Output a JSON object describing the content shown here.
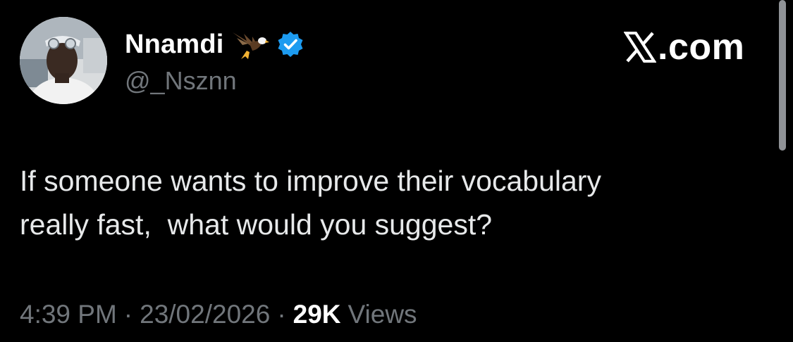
{
  "author": {
    "display_name": "Nnamdi",
    "emoji": "eagle-emoji",
    "verified": true,
    "verified_color": "#1d9bf0",
    "handle": "@_Nsznn",
    "avatar_icon": "profile-photo"
  },
  "watermark": {
    "logo": "x-logo-icon",
    "text": ".com"
  },
  "tweet": {
    "text": "If someone wants to improve their vocabulary\nreally fast,  what would you suggest?"
  },
  "meta": {
    "time": "4:39 PM",
    "separator": "·",
    "date": "23/02/2026",
    "views_count": "29K",
    "views_label": "Views"
  },
  "colors": {
    "background": "#000000",
    "primary_text": "#e7e9ea",
    "secondary_text": "#71767b",
    "accent": "#1d9bf0"
  }
}
